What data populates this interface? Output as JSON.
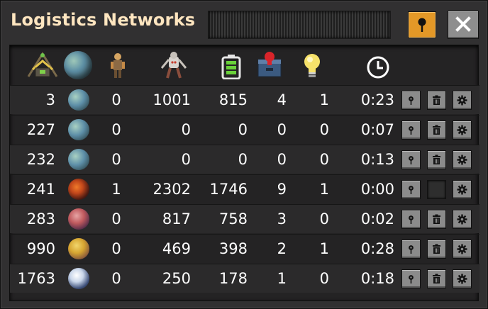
{
  "window": {
    "title": "Logistics Networks"
  },
  "columns": [
    {
      "icon": "roboport-icon"
    },
    {
      "icon": "planet-icon"
    },
    {
      "icon": "construction-robot-icon"
    },
    {
      "icon": "logistic-robot-icon"
    },
    {
      "icon": "battery-icon"
    },
    {
      "icon": "requester-chest-icon"
    },
    {
      "icon": "lightbulb-icon"
    },
    {
      "icon": "clock-icon"
    }
  ],
  "rows": [
    {
      "id": "3",
      "planet": "nauvis",
      "construction": "0",
      "logistic": "1001",
      "charging": "815",
      "requests": "4",
      "provides": "1",
      "time": "0:23",
      "delete_enabled": true
    },
    {
      "id": "227",
      "planet": "nauvis",
      "construction": "0",
      "logistic": "0",
      "charging": "0",
      "requests": "0",
      "provides": "0",
      "time": "0:07",
      "delete_enabled": true
    },
    {
      "id": "232",
      "planet": "nauvis",
      "construction": "0",
      "logistic": "0",
      "charging": "0",
      "requests": "0",
      "provides": "0",
      "time": "0:13",
      "delete_enabled": true
    },
    {
      "id": "241",
      "planet": "vulcanus",
      "construction": "1",
      "logistic": "2302",
      "charging": "1746",
      "requests": "9",
      "provides": "1",
      "time": "0:00",
      "delete_enabled": false
    },
    {
      "id": "283",
      "planet": "gleba",
      "construction": "0",
      "logistic": "817",
      "charging": "758",
      "requests": "3",
      "provides": "0",
      "time": "0:02",
      "delete_enabled": true
    },
    {
      "id": "990",
      "planet": "fulgora",
      "construction": "0",
      "logistic": "469",
      "charging": "398",
      "requests": "2",
      "provides": "1",
      "time": "0:28",
      "delete_enabled": true
    },
    {
      "id": "1763",
      "planet": "aquilo",
      "construction": "0",
      "logistic": "250",
      "charging": "178",
      "requests": "1",
      "provides": "0",
      "time": "0:18",
      "delete_enabled": true
    }
  ],
  "colors": {
    "title": "#ffe6c0",
    "pin_active": "#e39827",
    "nauvis": "#5e8fa8",
    "vulcanus": "#c2471b",
    "gleba": "#c05a5e",
    "fulgora": "#d6a531",
    "aquilo": "#c9d6ea"
  }
}
